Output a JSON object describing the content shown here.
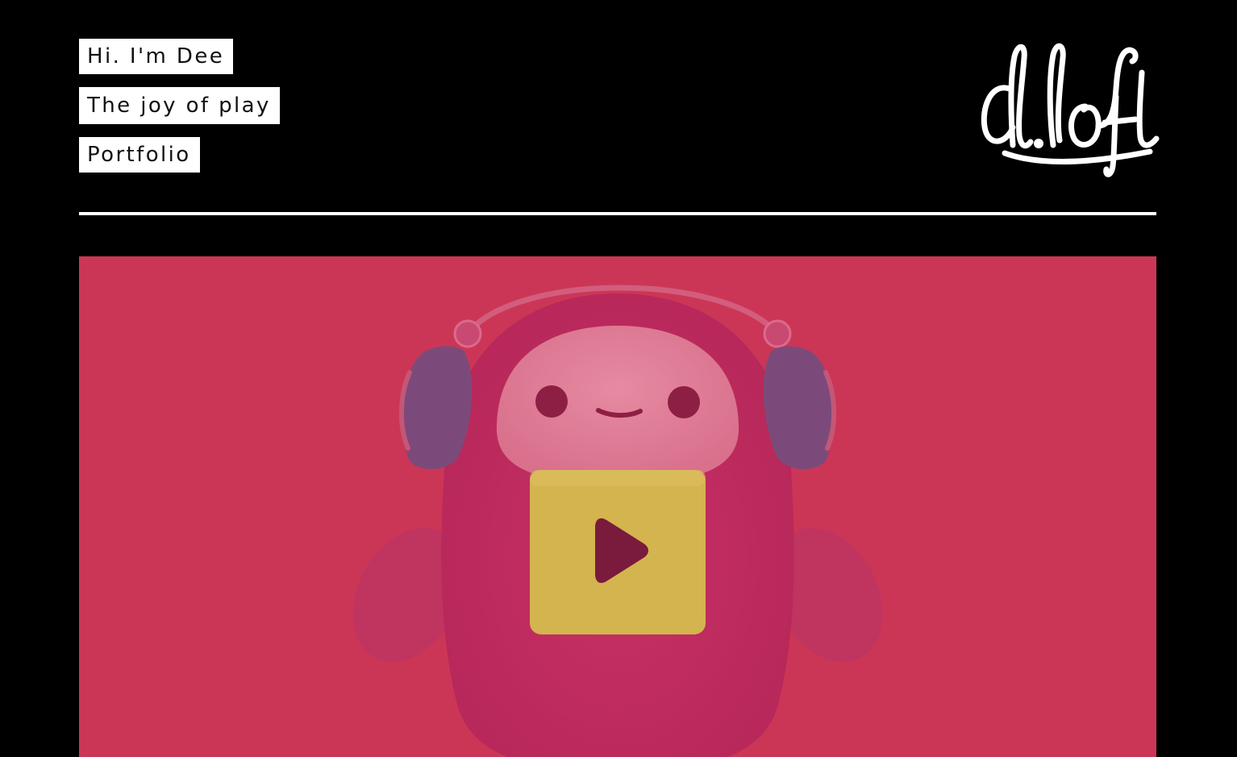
{
  "nav": {
    "items": [
      {
        "label": "Hi. I'm Dee"
      },
      {
        "label": "The joy of play"
      },
      {
        "label": "Portfolio"
      }
    ]
  },
  "logo": {
    "text": "d.loft",
    "icon": "dloft-logo"
  },
  "video": {
    "icon": "play-icon",
    "background_color": "#cc3656",
    "character": "robot-mascot-with-headphones"
  },
  "colors": {
    "page_background": "#000000",
    "nav_background": "#ffffff",
    "nav_text": "#111111",
    "play_button": "#d4b44e",
    "play_triangle": "#7a1a3c"
  }
}
